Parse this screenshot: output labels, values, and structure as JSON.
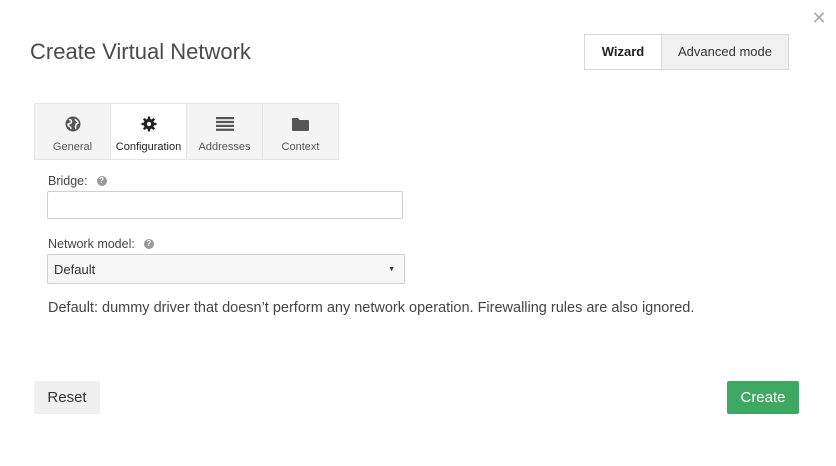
{
  "dialog": {
    "title": "Create Virtual Network",
    "close_icon": "close-icon"
  },
  "modes": {
    "wizard_label": "Wizard",
    "advanced_label": "Advanced mode",
    "active": "Wizard"
  },
  "tabs": [
    {
      "label": "General",
      "icon": "globe-icon"
    },
    {
      "label": "Configuration",
      "icon": "gear-icon"
    },
    {
      "label": "Addresses",
      "icon": "list-icon"
    },
    {
      "label": "Context",
      "icon": "folder-icon"
    }
  ],
  "active_tab": "Configuration",
  "form": {
    "bridge_label": "Bridge:",
    "bridge_value": "",
    "network_model_label": "Network model:",
    "network_model_value": "Default",
    "help_icon": "help-icon",
    "description": "Default: dummy driver that doesn’t perform any network operation. Firewalling rules are also ignored."
  },
  "actions": {
    "reset_label": "Reset",
    "create_label": "Create"
  },
  "colors": {
    "create_button": "#3fa863",
    "title_text": "#4a4a4a"
  }
}
